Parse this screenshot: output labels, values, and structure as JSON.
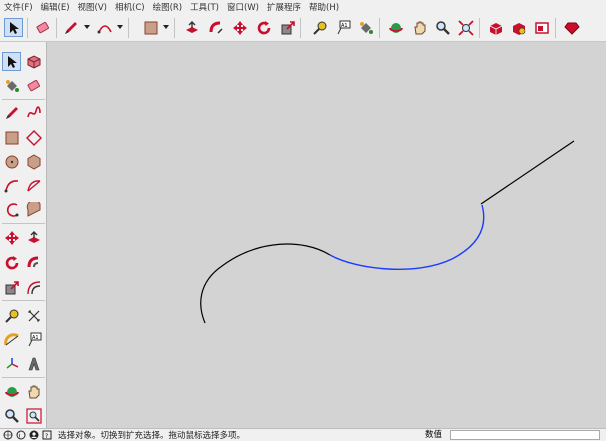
{
  "menubar": {
    "items": [
      "文件(F)",
      "编辑(E)",
      "视图(V)",
      "相机(C)",
      "绘图(R)",
      "工具(T)",
      "窗口(W)",
      "扩展程序",
      "帮助(H)"
    ]
  },
  "toolbar": {
    "icons": [
      "select-icon",
      "eraser-icon",
      "pencil-icon",
      "arc-icon",
      "rectangle-icon",
      "push-pull-icon",
      "move-icon",
      "rotate-icon",
      "scale-icon",
      "offset-icon",
      "tape-measure-icon",
      "text-icon",
      "paint-bucket-icon",
      "orbit-icon",
      "pan-icon",
      "zoom-icon",
      "zoom-extents-icon",
      "warehouse-icon",
      "extension-warehouse-icon",
      "layout-icon",
      "ruby-icon"
    ]
  },
  "lefttoolbar": {
    "icons": [
      "select-icon",
      "component-icon",
      "paint-bucket-icon",
      "eraser-icon",
      "line-icon",
      "freehand-icon",
      "rectangle-icon",
      "rotated-rectangle-icon",
      "circle-icon",
      "polygon-icon",
      "arc-icon",
      "pie-icon",
      "two-point-arc-icon",
      "three-point-arc-icon",
      "move-icon",
      "push-pull-icon",
      "rotate-icon",
      "follow-me-icon",
      "scale-icon",
      "offset-icon",
      "tape-measure-icon",
      "dimension-icon",
      "protractor-icon",
      "text-icon",
      "axes-icon",
      "3d-text-icon",
      "orbit-icon",
      "pan-icon",
      "zoom-icon",
      "zoom-window-icon"
    ]
  },
  "status": {
    "message": "选择对象。切换到扩充选择。拖动鼠标选择多项。",
    "measurements_label": "数值",
    "measurements_value": ""
  },
  "colors": {
    "viewport_background": "#d3d3d3",
    "edge_default": "#000000",
    "edge_selected": "#1a3cff"
  }
}
